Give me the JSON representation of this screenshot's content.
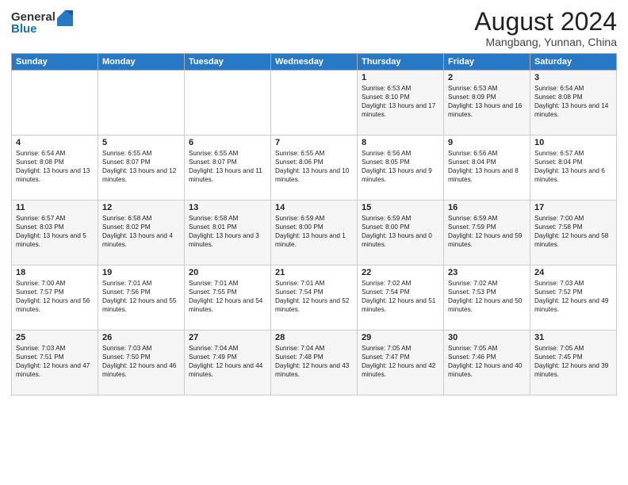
{
  "logo": {
    "general": "General",
    "blue": "Blue"
  },
  "title": {
    "month_year": "August 2024",
    "location": "Mangbang, Yunnan, China"
  },
  "header_days": [
    "Sunday",
    "Monday",
    "Tuesday",
    "Wednesday",
    "Thursday",
    "Friday",
    "Saturday"
  ],
  "weeks": [
    [
      {
        "day": "",
        "sunrise": "",
        "sunset": "",
        "daylight": ""
      },
      {
        "day": "",
        "sunrise": "",
        "sunset": "",
        "daylight": ""
      },
      {
        "day": "",
        "sunrise": "",
        "sunset": "",
        "daylight": ""
      },
      {
        "day": "",
        "sunrise": "",
        "sunset": "",
        "daylight": ""
      },
      {
        "day": "1",
        "sunrise": "Sunrise: 6:53 AM",
        "sunset": "Sunset: 8:10 PM",
        "daylight": "Daylight: 13 hours and 17 minutes."
      },
      {
        "day": "2",
        "sunrise": "Sunrise: 6:53 AM",
        "sunset": "Sunset: 8:09 PM",
        "daylight": "Daylight: 13 hours and 16 minutes."
      },
      {
        "day": "3",
        "sunrise": "Sunrise: 6:54 AM",
        "sunset": "Sunset: 8:08 PM",
        "daylight": "Daylight: 13 hours and 14 minutes."
      }
    ],
    [
      {
        "day": "4",
        "sunrise": "Sunrise: 6:54 AM",
        "sunset": "Sunset: 8:08 PM",
        "daylight": "Daylight: 13 hours and 13 minutes."
      },
      {
        "day": "5",
        "sunrise": "Sunrise: 6:55 AM",
        "sunset": "Sunset: 8:07 PM",
        "daylight": "Daylight: 13 hours and 12 minutes."
      },
      {
        "day": "6",
        "sunrise": "Sunrise: 6:55 AM",
        "sunset": "Sunset: 8:07 PM",
        "daylight": "Daylight: 13 hours and 11 minutes."
      },
      {
        "day": "7",
        "sunrise": "Sunrise: 6:55 AM",
        "sunset": "Sunset: 8:06 PM",
        "daylight": "Daylight: 13 hours and 10 minutes."
      },
      {
        "day": "8",
        "sunrise": "Sunrise: 6:56 AM",
        "sunset": "Sunset: 8:05 PM",
        "daylight": "Daylight: 13 hours and 9 minutes."
      },
      {
        "day": "9",
        "sunrise": "Sunrise: 6:56 AM",
        "sunset": "Sunset: 8:04 PM",
        "daylight": "Daylight: 13 hours and 8 minutes."
      },
      {
        "day": "10",
        "sunrise": "Sunrise: 6:57 AM",
        "sunset": "Sunset: 8:04 PM",
        "daylight": "Daylight: 13 hours and 6 minutes."
      }
    ],
    [
      {
        "day": "11",
        "sunrise": "Sunrise: 6:57 AM",
        "sunset": "Sunset: 8:03 PM",
        "daylight": "Daylight: 13 hours and 5 minutes."
      },
      {
        "day": "12",
        "sunrise": "Sunrise: 6:58 AM",
        "sunset": "Sunset: 8:02 PM",
        "daylight": "Daylight: 13 hours and 4 minutes."
      },
      {
        "day": "13",
        "sunrise": "Sunrise: 6:58 AM",
        "sunset": "Sunset: 8:01 PM",
        "daylight": "Daylight: 13 hours and 3 minutes."
      },
      {
        "day": "14",
        "sunrise": "Sunrise: 6:59 AM",
        "sunset": "Sunset: 8:00 PM",
        "daylight": "Daylight: 13 hours and 1 minute."
      },
      {
        "day": "15",
        "sunrise": "Sunrise: 6:59 AM",
        "sunset": "Sunset: 8:00 PM",
        "daylight": "Daylight: 13 hours and 0 minutes."
      },
      {
        "day": "16",
        "sunrise": "Sunrise: 6:59 AM",
        "sunset": "Sunset: 7:59 PM",
        "daylight": "Daylight: 12 hours and 59 minutes."
      },
      {
        "day": "17",
        "sunrise": "Sunrise: 7:00 AM",
        "sunset": "Sunset: 7:58 PM",
        "daylight": "Daylight: 12 hours and 58 minutes."
      }
    ],
    [
      {
        "day": "18",
        "sunrise": "Sunrise: 7:00 AM",
        "sunset": "Sunset: 7:57 PM",
        "daylight": "Daylight: 12 hours and 56 minutes."
      },
      {
        "day": "19",
        "sunrise": "Sunrise: 7:01 AM",
        "sunset": "Sunset: 7:56 PM",
        "daylight": "Daylight: 12 hours and 55 minutes."
      },
      {
        "day": "20",
        "sunrise": "Sunrise: 7:01 AM",
        "sunset": "Sunset: 7:55 PM",
        "daylight": "Daylight: 12 hours and 54 minutes."
      },
      {
        "day": "21",
        "sunrise": "Sunrise: 7:01 AM",
        "sunset": "Sunset: 7:54 PM",
        "daylight": "Daylight: 12 hours and 52 minutes."
      },
      {
        "day": "22",
        "sunrise": "Sunrise: 7:02 AM",
        "sunset": "Sunset: 7:54 PM",
        "daylight": "Daylight: 12 hours and 51 minutes."
      },
      {
        "day": "23",
        "sunrise": "Sunrise: 7:02 AM",
        "sunset": "Sunset: 7:53 PM",
        "daylight": "Daylight: 12 hours and 50 minutes."
      },
      {
        "day": "24",
        "sunrise": "Sunrise: 7:03 AM",
        "sunset": "Sunset: 7:52 PM",
        "daylight": "Daylight: 12 hours and 49 minutes."
      }
    ],
    [
      {
        "day": "25",
        "sunrise": "Sunrise: 7:03 AM",
        "sunset": "Sunset: 7:51 PM",
        "daylight": "Daylight: 12 hours and 47 minutes."
      },
      {
        "day": "26",
        "sunrise": "Sunrise: 7:03 AM",
        "sunset": "Sunset: 7:50 PM",
        "daylight": "Daylight: 12 hours and 46 minutes."
      },
      {
        "day": "27",
        "sunrise": "Sunrise: 7:04 AM",
        "sunset": "Sunset: 7:49 PM",
        "daylight": "Daylight: 12 hours and 44 minutes."
      },
      {
        "day": "28",
        "sunrise": "Sunrise: 7:04 AM",
        "sunset": "Sunset: 7:48 PM",
        "daylight": "Daylight: 12 hours and 43 minutes."
      },
      {
        "day": "29",
        "sunrise": "Sunrise: 7:05 AM",
        "sunset": "Sunset: 7:47 PM",
        "daylight": "Daylight: 12 hours and 42 minutes."
      },
      {
        "day": "30",
        "sunrise": "Sunrise: 7:05 AM",
        "sunset": "Sunset: 7:46 PM",
        "daylight": "Daylight: 12 hours and 40 minutes."
      },
      {
        "day": "31",
        "sunrise": "Sunrise: 7:05 AM",
        "sunset": "Sunset: 7:45 PM",
        "daylight": "Daylight: 12 hours and 39 minutes."
      }
    ]
  ]
}
